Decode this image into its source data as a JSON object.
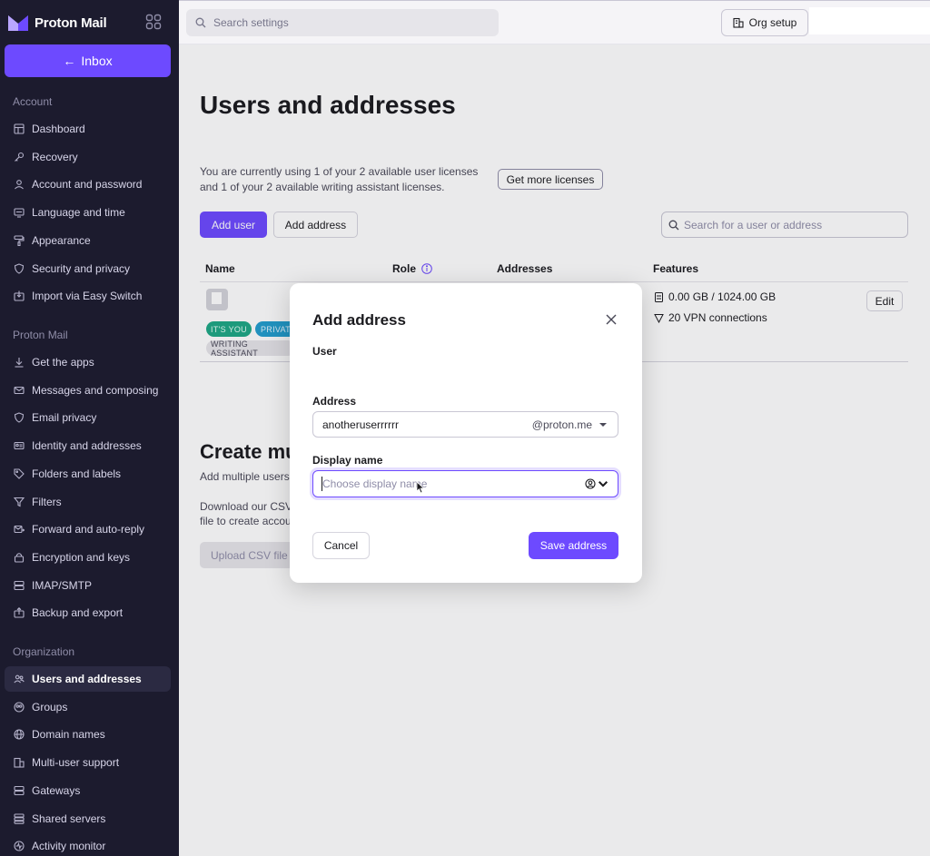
{
  "app": {
    "name": "Proton Mail"
  },
  "sidebar": {
    "inbox_label": "Inbox",
    "sections": {
      "account": "Account",
      "mail": "Proton Mail",
      "organization": "Organization"
    },
    "account_items": [
      {
        "label": "Dashboard",
        "icon": "dashboard-icon"
      },
      {
        "label": "Recovery",
        "icon": "key-icon"
      },
      {
        "label": "Account and password",
        "icon": "user-icon"
      },
      {
        "label": "Language and time",
        "icon": "language-icon"
      },
      {
        "label": "Appearance",
        "icon": "paint-roller-icon"
      },
      {
        "label": "Security and privacy",
        "icon": "shield-icon"
      },
      {
        "label": "Import via Easy Switch",
        "icon": "import-icon"
      }
    ],
    "mail_items": [
      {
        "label": "Get the apps",
        "icon": "download-icon"
      },
      {
        "label": "Messages and composing",
        "icon": "envelope-icon"
      },
      {
        "label": "Email privacy",
        "icon": "shield-icon"
      },
      {
        "label": "Identity and addresses",
        "icon": "card-icon"
      },
      {
        "label": "Folders and labels",
        "icon": "tag-icon"
      },
      {
        "label": "Filters",
        "icon": "filter-icon"
      },
      {
        "label": "Forward and auto-reply",
        "icon": "forward-icon"
      },
      {
        "label": "Encryption and keys",
        "icon": "lock-icon"
      },
      {
        "label": "IMAP/SMTP",
        "icon": "server-icon"
      },
      {
        "label": "Backup and export",
        "icon": "export-icon"
      }
    ],
    "org_items": [
      {
        "label": "Users and addresses",
        "icon": "users-icon",
        "active": true
      },
      {
        "label": "Groups",
        "icon": "group-icon"
      },
      {
        "label": "Domain names",
        "icon": "globe-icon"
      },
      {
        "label": "Multi-user support",
        "icon": "buildings-icon"
      },
      {
        "label": "Gateways",
        "icon": "server-icon"
      },
      {
        "label": "Shared servers",
        "icon": "servers-icon"
      },
      {
        "label": "Activity monitor",
        "icon": "activity-icon"
      }
    ]
  },
  "topbar": {
    "search_placeholder": "Search settings",
    "org_setup_label": "Org setup"
  },
  "main": {
    "title": "Users and addresses",
    "license_text": "You are currently using 1 of your 2 available user licenses and 1 of your 2 available writing assistant licenses.",
    "get_more_licenses": "Get more licenses",
    "add_user": "Add user",
    "add_address": "Add address",
    "user_search_placeholder": "Search for a user or address",
    "table": {
      "headers": {
        "name": "Name",
        "role": "Role",
        "addresses": "Addresses",
        "features": "Features"
      },
      "row": {
        "badges": [
          "IT'S YOU",
          "PRIVATE",
          "WRITING ASSISTANT"
        ],
        "storage": "0.00 GB / 1024.00 GB",
        "vpn": "20 VPN connections",
        "edit": "Edit"
      }
    },
    "create_title": "Create mu",
    "create_sub": "Add multiple users",
    "create_desc": "Download our CSV file to create accou",
    "upload_csv": "Upload CSV file"
  },
  "modal": {
    "title": "Add address",
    "user_label": "User",
    "address_label": "Address",
    "address_value": "anotheruserrrrrr",
    "domain": "@proton.me",
    "display_name_label": "Display name",
    "display_name_placeholder": "Choose display name",
    "cancel": "Cancel",
    "save": "Save address"
  },
  "colors": {
    "accent": "#6d4aff",
    "sidebar_bg": "#1c1b2e"
  }
}
